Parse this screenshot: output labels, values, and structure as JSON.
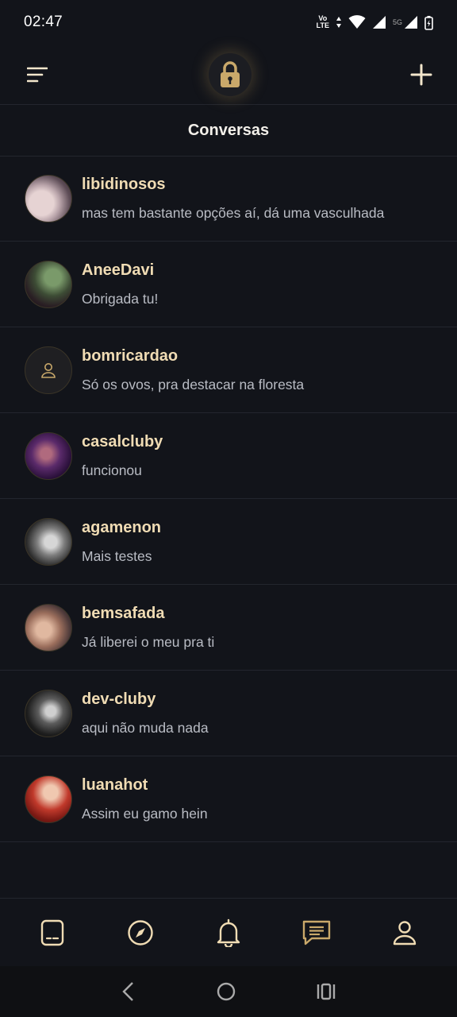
{
  "status_bar": {
    "time": "02:47",
    "volte_top": "Vo",
    "volte_bottom": "LTE",
    "network": "5G"
  },
  "header": {
    "menu_icon": "sort-menu-icon",
    "logo_icon": "padlock-icon",
    "add_icon": "plus-icon"
  },
  "page": {
    "title": "Conversas"
  },
  "conversations": [
    {
      "name": "libidinosos",
      "message": "mas tem bastante opções aí, dá uma vasculhada"
    },
    {
      "name": "AneeDavi",
      "message": "Obrigada tu!"
    },
    {
      "name": "bomricardao",
      "message": "Só os ovos, pra destacar na floresta"
    },
    {
      "name": "casalcluby",
      "message": "funcionou"
    },
    {
      "name": "agamenon",
      "message": "Mais testes"
    },
    {
      "name": "bemsafada",
      "message": "Já liberei o meu pra ti"
    },
    {
      "name": "dev-cluby",
      "message": "aqui não muda nada"
    },
    {
      "name": "luanahot",
      "message": "Assim eu gamo hein"
    }
  ],
  "bottom_nav": [
    "feed-card-icon",
    "compass-icon",
    "bell-icon",
    "chat-icon",
    "profile-icon"
  ],
  "colors": {
    "accent": "#c9a86a",
    "name_text": "#f0dcb4",
    "background": "#12141a"
  }
}
